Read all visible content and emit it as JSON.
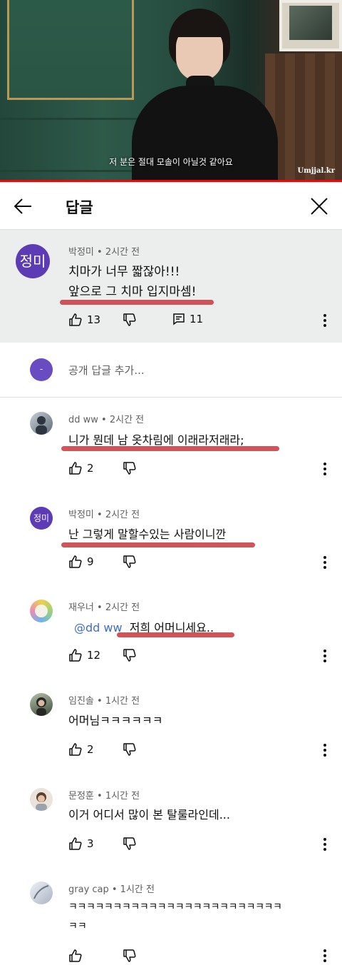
{
  "video": {
    "subtitle": "저 분은 절대 모솔이 아닐것 같아요",
    "watermark": "Umjjal.kr",
    "progress_fraction": 1.0
  },
  "header": {
    "title": "답글",
    "back_icon": "arrow-left-icon",
    "close_icon": "close-icon"
  },
  "root_comment": {
    "avatar_text": "정미",
    "avatar_color": "#5c3bb5",
    "author_time": "박정미 • 2시간 전",
    "line1": "치마가 너무 짧잖아!!!",
    "line2": "앞으로 그 치마 입지마셈!",
    "likes": "13",
    "replies": "11"
  },
  "add_reply": {
    "avatar_text": "-",
    "placeholder": "공개 답글 추가..."
  },
  "replies": [
    {
      "author_time": "dd ww • 2시간 전",
      "text": "니가 뭔데 남 옷차림에 이래라저래라;",
      "likes": "2"
    },
    {
      "author_time": "박정미 • 2시간 전",
      "avatar_text": "정미",
      "text": "난 그렇게 말할수있는 사람이니깐",
      "likes": "9"
    },
    {
      "author_time": "재우너 • 2시간 전",
      "mention": "@dd ww",
      "text": "저희 어머니세요..",
      "likes": "12"
    },
    {
      "author_time": "임진솔 • 1시간 전",
      "text": "어머님ㅋㅋㅋㅋㅋㅋ",
      "likes": "2"
    },
    {
      "author_time": "문정훈 • 1시간 전",
      "text": "이거 어디서 많이 본 탈룰라인데...",
      "likes": "3"
    },
    {
      "author_time": "gray cap • 1시간 전",
      "text_line1": "ㅋㅋㅋㅋㅋㅋㅋㅋㅋㅋㅋㅋㅋㅋㅋㅋㅋㅋㅋㅋㅋㅋㅋㅋ",
      "text_line2": "ㅋㅋ",
      "likes": ""
    }
  ],
  "colors": {
    "highlight_bg": "#eceeed",
    "underline": "#c9363c",
    "mention": "#3e6ec8"
  }
}
